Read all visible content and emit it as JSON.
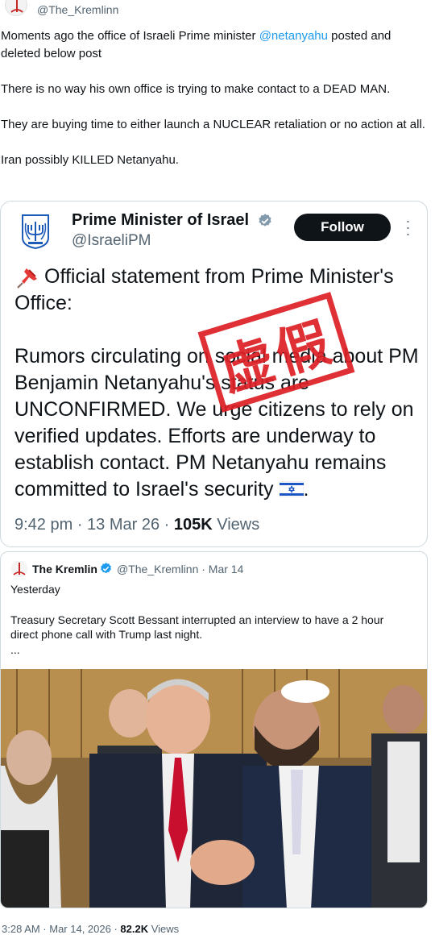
{
  "header": {
    "handle": "@The_Kremlinn"
  },
  "tweet": {
    "lead": "Moments ago the office of Israeli Prime minister ",
    "mention": "@netanyahu",
    "lead_end": " posted and deleted below post",
    "para2": "There is no way his own office is trying to make contact to a DEAD MAN.",
    "para3": "They are buying time to either launch a NUCLEAR retaliation or no action at all.",
    "para4": "Iran possibly KILLED Netanyahu."
  },
  "embed": {
    "name": "Prime Minister of Israel",
    "handle": "@IsraeliPM",
    "follow_label": "Follow",
    "statement": "Official statement from Prime Minister's Office:",
    "body": "Rumors circulating on social media about PM Benjamin Netanyahu's status are UNCONFIRMED. We urge citizens to rely on verified updates. Efforts are underway to establish contact. PM Netanyahu remains committed to Israel's security",
    "body_end": ".",
    "stamp_text": "虚假",
    "time": "9:42 pm · 13 Mar 26 · ",
    "views_count": "105K",
    "views_label": " Views"
  },
  "quote": {
    "name": "The Kremlin",
    "handle_date": "@The_Kremlinn · Mar 14",
    "line1": "Yesterday",
    "body": "Treasury Secretary Scott Bessant interrupted an interview to have a 2 hour direct  phone call with Trump last night.",
    "ellipsis": "..."
  },
  "footer": {
    "time": "3:28 AM · Mar 14, 2026 · ",
    "views_count": "82.2K",
    "views_label": " Views"
  },
  "colors": {
    "link": "#1d9bf0",
    "verified_blue": "#1d9bf0",
    "verified_gray": "#829aab",
    "stamp_red": "#dd1f26",
    "button_dark": "#0f1419"
  },
  "icons": [
    "kremlin-avatar-icon",
    "israel-emblem-icon",
    "verified-badge-icon",
    "more-icon",
    "pushpin-icon",
    "israel-flag-icon"
  ]
}
